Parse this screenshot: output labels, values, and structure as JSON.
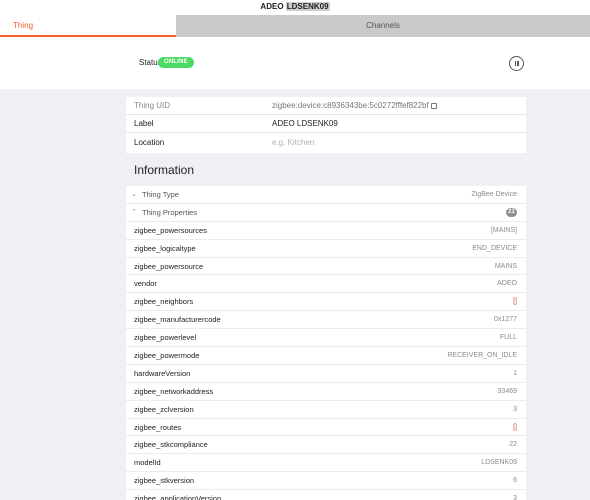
{
  "window": {
    "title_prefix": "ADEO ",
    "title_highlight": "LDSENK09"
  },
  "tabs": [
    {
      "label": "Thing"
    },
    {
      "label": "Channels"
    }
  ],
  "status": {
    "label": "Status:",
    "badge": "ONLINE"
  },
  "summary": {
    "rows": [
      {
        "key": "Thing UID",
        "value": "zigbee:device:c8936343be:5c0272fffef822bf"
      },
      {
        "key": "Label",
        "value": "ADEO LDSENK09"
      },
      {
        "key": "Location",
        "placeholder": "e.g. Kitchen"
      }
    ]
  },
  "information": {
    "title": "Information",
    "thing_type": {
      "label": "Thing Type",
      "value": "ZigBee Device"
    },
    "thing_properties": {
      "label": "Thing Properties",
      "count": "21"
    },
    "properties": [
      {
        "key": "zigbee_powersources",
        "value": "[MAINS]"
      },
      {
        "key": "zigbee_logicaltype",
        "value": "END_DEVICE"
      },
      {
        "key": "zigbee_powersource",
        "value": "MAINS"
      },
      {
        "key": "vendor",
        "value": "ADEO"
      },
      {
        "key": "zigbee_neighbors",
        "value": "[]"
      },
      {
        "key": "zigbee_manufacturercode",
        "value": "0x1277"
      },
      {
        "key": "zigbee_powerlevel",
        "value": "FULL"
      },
      {
        "key": "zigbee_powermode",
        "value": "RECEIVER_ON_IDLE"
      },
      {
        "key": "hardwareVersion",
        "value": "1"
      },
      {
        "key": "zigbee_networkaddress",
        "value": "33469"
      },
      {
        "key": "zigbee_zclversion",
        "value": "3"
      },
      {
        "key": "zigbee_routes",
        "value": "[]"
      },
      {
        "key": "zigbee_stkcompliance",
        "value": "22"
      },
      {
        "key": "modelId",
        "value": "LDSENK09"
      },
      {
        "key": "zigbee_stkversion",
        "value": "6"
      },
      {
        "key": "zigbee_applicationVersion",
        "value": "3"
      }
    ]
  },
  "colors": {
    "accent": "#f15d2a",
    "online": "#4cd964",
    "empty_list": "#d9534f"
  }
}
